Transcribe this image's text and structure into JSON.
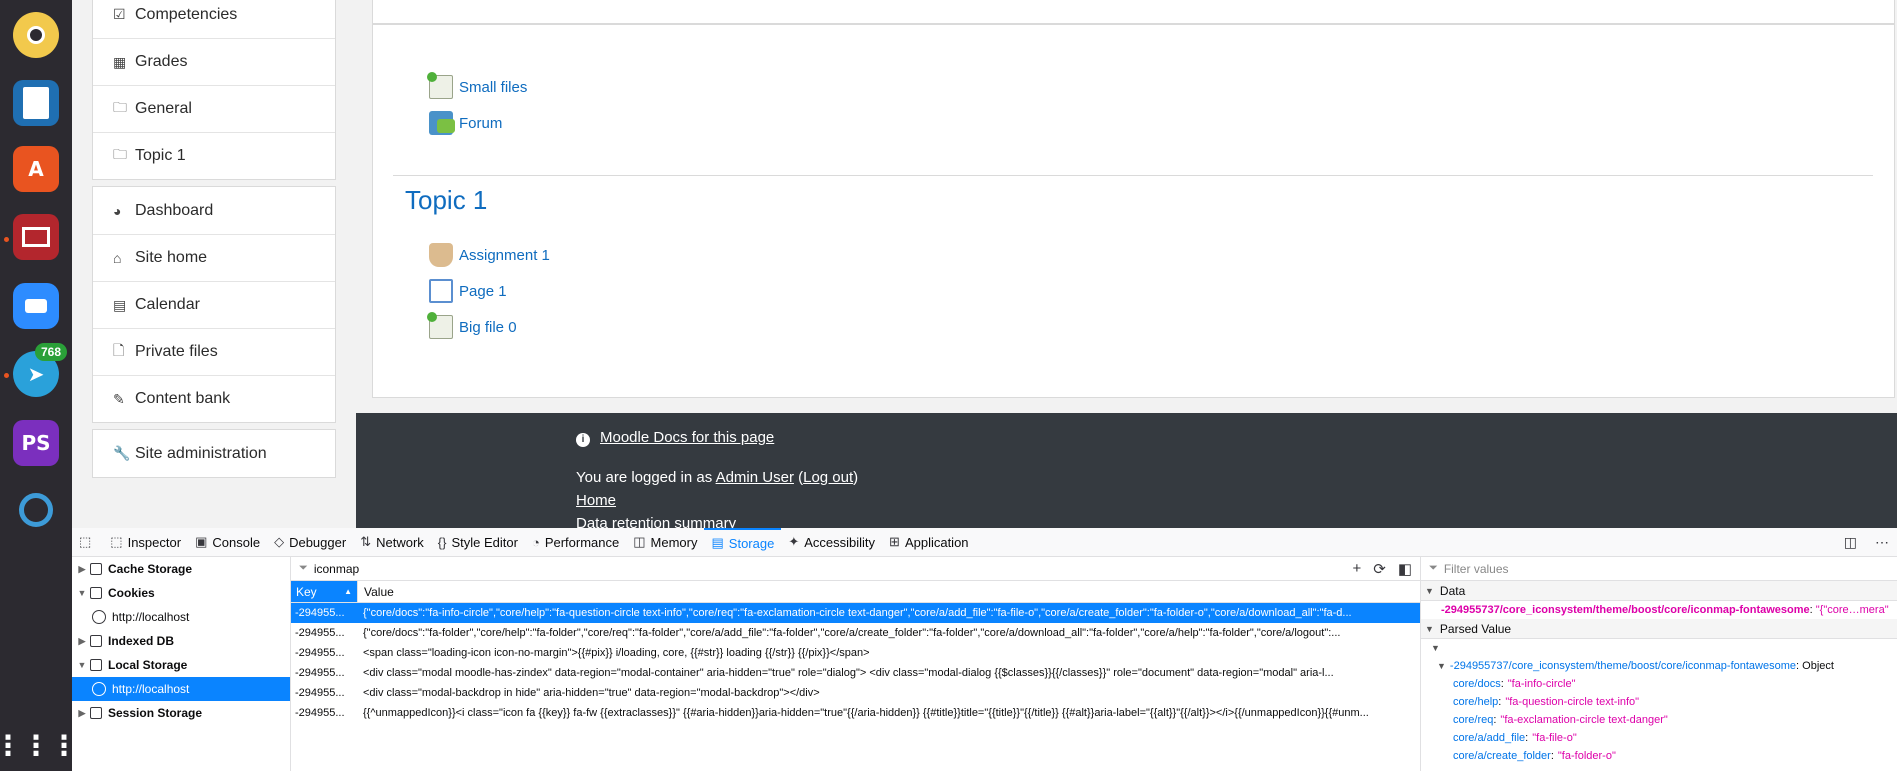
{
  "dock": {
    "telegram_badge": "768"
  },
  "leftnav": {
    "group1": [
      {
        "icon": "checkbox-icon",
        "glyph": "☑",
        "label": "Competencies"
      },
      {
        "icon": "table-icon",
        "glyph": "▦",
        "label": "Grades"
      },
      {
        "icon": "folder-icon",
        "glyph": "🗀",
        "label": "General"
      },
      {
        "icon": "folder-icon",
        "glyph": "🗀",
        "label": "Topic 1"
      }
    ],
    "group2": [
      {
        "icon": "dashboard-icon",
        "glyph": "◕",
        "label": "Dashboard"
      },
      {
        "icon": "home-icon",
        "glyph": "⌂",
        "label": "Site home"
      },
      {
        "icon": "calendar-icon",
        "glyph": "▤",
        "label": "Calendar"
      },
      {
        "icon": "file-icon",
        "glyph": "🗋",
        "label": "Private files"
      },
      {
        "icon": "brush-icon",
        "glyph": "✎",
        "label": "Content bank"
      }
    ],
    "group3": [
      {
        "icon": "wrench-icon",
        "glyph": "🔧",
        "label": "Site administration"
      }
    ]
  },
  "course": {
    "general_activities": [
      "Small files",
      "Forum"
    ],
    "topic_title": "Topic 1",
    "topic_activities": [
      "Assignment 1",
      "Page 1",
      "Big file 0"
    ]
  },
  "footer": {
    "docs_link": "Moodle Docs for this page",
    "logged_in_prefix": "You are logged in as ",
    "user": "Admin User",
    "logout": "Log out",
    "home": "Home",
    "data_retention": "Data retention summary"
  },
  "devtools": {
    "tabs": [
      "Inspector",
      "Console",
      "Debugger",
      "Network",
      "Style Editor",
      "Performance",
      "Memory",
      "Storage",
      "Accessibility",
      "Application"
    ],
    "active_tab": "Storage",
    "tree": [
      {
        "label": "Cache Storage",
        "level": 0,
        "arrow": "▶"
      },
      {
        "label": "Cookies",
        "level": 0,
        "arrow": "▼"
      },
      {
        "label": "http://localhost",
        "level": 1
      },
      {
        "label": "Indexed DB",
        "level": 0,
        "arrow": "▶"
      },
      {
        "label": "Local Storage",
        "level": 0,
        "arrow": "▼"
      },
      {
        "label": "http://localhost",
        "level": 1,
        "selected": true
      },
      {
        "label": "Session Storage",
        "level": 0,
        "arrow": "▶"
      }
    ],
    "filter_value": "iconmap",
    "columns": {
      "key": "Key",
      "value": "Value"
    },
    "rows": [
      {
        "key": "-294955...",
        "value": "{\"core/docs\":\"fa-info-circle\",\"core/help\":\"fa-question-circle text-info\",\"core/req\":\"fa-exclamation-circle text-danger\",\"core/a/add_file\":\"fa-file-o\",\"core/a/create_folder\":\"fa-folder-o\",\"core/a/download_all\":\"fa-d..."
      },
      {
        "key": "-294955...",
        "value": "{\"core/docs\":\"fa-folder\",\"core/help\":\"fa-folder\",\"core/req\":\"fa-folder\",\"core/a/add_file\":\"fa-folder\",\"core/a/create_folder\":\"fa-folder\",\"core/a/download_all\":\"fa-folder\",\"core/a/help\":\"fa-folder\",\"core/a/logout\":..."
      },
      {
        "key": "-294955...",
        "value": "<span class=\"loading-icon icon-no-margin\">{{#pix}} i/loading, core, {{#str}} loading {{/str}} {{/pix}}</span>"
      },
      {
        "key": "-294955...",
        "value": "<div class=\"modal moodle-has-zindex\" data-region=\"modal-container\" aria-hidden=\"true\" role=\"dialog\">   <div class=\"modal-dialog {{$classes}}{{/classes}}\" role=\"document\" data-region=\"modal\" aria-l..."
      },
      {
        "key": "-294955...",
        "value": "<div class=\"modal-backdrop in hide\" aria-hidden=\"true\" data-region=\"modal-backdrop\"></div>"
      },
      {
        "key": "-294955...",
        "value": "{{^unmappedIcon}}<i class=\"icon fa {{key}} fa-fw {{extraclasses}}\" {{#aria-hidden}}aria-hidden=\"true\"{{/aria-hidden}} {{#title}}title=\"{{title}}\"{{/title}} {{#alt}}aria-label=\"{{alt}}\"{{/alt}}></i>{{/unmappedIcon}}{{#unm..."
      }
    ],
    "side": {
      "filter_placeholder": "Filter values",
      "data_section": "Data",
      "data_key": "-294955737/core_iconsystem/theme/boost/core/iconmap-fontawesome",
      "data_value": "\"{\"core…mera\"",
      "parsed_section": "Parsed Value",
      "parsed_root_key": "-294955737/core_iconsystem/theme/boost/core/iconmap-fontawesome",
      "parsed_root_type": "Object",
      "parsed_entries": [
        {
          "k": "core/docs",
          "v": "\"fa-info-circle\""
        },
        {
          "k": "core/help",
          "v": "\"fa-question-circle text-info\""
        },
        {
          "k": "core/req",
          "v": "\"fa-exclamation-circle text-danger\""
        },
        {
          "k": "core/a/add_file",
          "v": "\"fa-file-o\""
        },
        {
          "k": "core/a/create_folder",
          "v": "\"fa-folder-o\""
        }
      ]
    }
  }
}
